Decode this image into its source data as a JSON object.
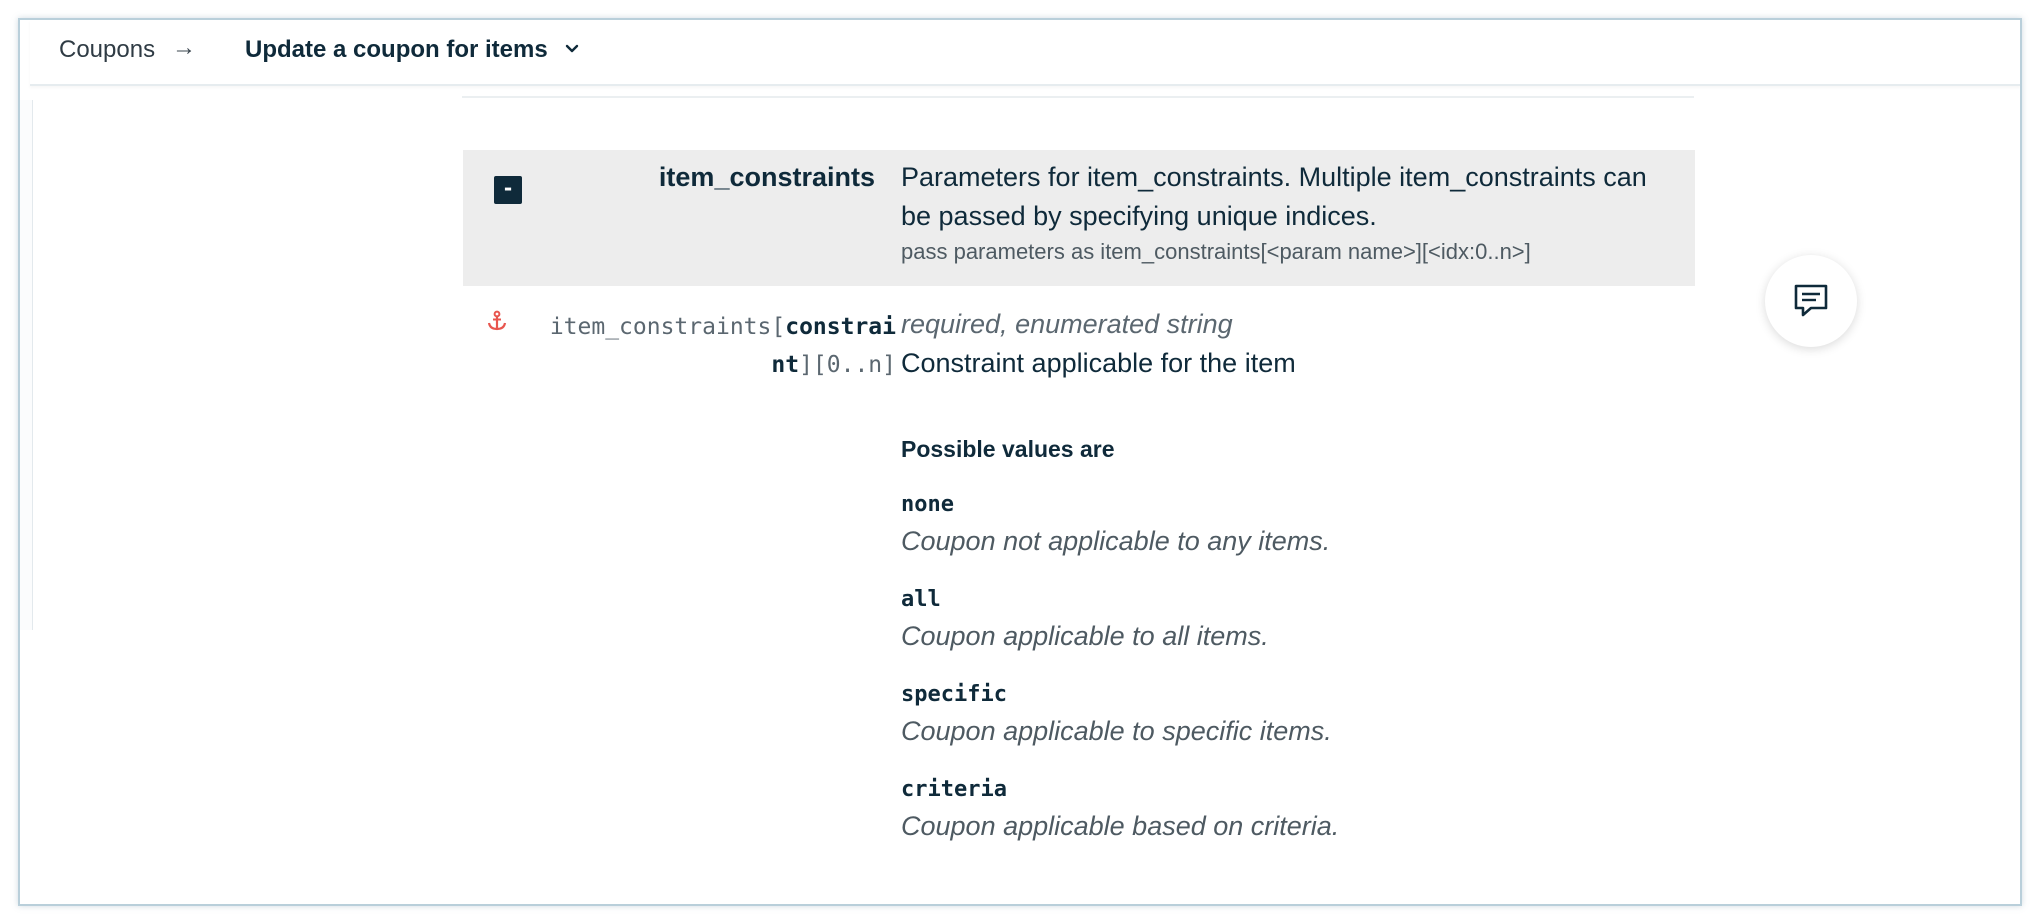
{
  "breadcrumb": {
    "root_label": "Coupons",
    "arrow": "→",
    "current_label": "Update a coupon for items"
  },
  "parent_param": {
    "toggle_label": "-",
    "name": "item_constraints",
    "description": "Parameters for item_constraints. Multiple item_constraints can be passed by specifying unique indices.",
    "note": "pass parameters as item_constraints[<param name>][<idx:0..n>]"
  },
  "child_param": {
    "name_prefix": "item_constraints[",
    "name_bold": "constrai nt",
    "name_suffix": "][0..n]",
    "type": "required, enumerated string",
    "description": "Constraint applicable for the item",
    "values_heading": "Possible values are",
    "values": [
      {
        "code": "none",
        "desc": "Coupon not applicable to any items."
      },
      {
        "code": "all",
        "desc": "Coupon applicable to all items."
      },
      {
        "code": "specific",
        "desc": "Coupon applicable to specific items."
      },
      {
        "code": "criteria",
        "desc": "Coupon applicable based on criteria."
      }
    ]
  },
  "icons": {
    "anchor": "anchor-icon",
    "chevron": "chevron-down-icon",
    "feedback": "chat-bubble-icon"
  },
  "colors": {
    "primary_text": "#0f2a3a",
    "anchor_accent": "#e8554e",
    "header_band": "#ededed"
  }
}
